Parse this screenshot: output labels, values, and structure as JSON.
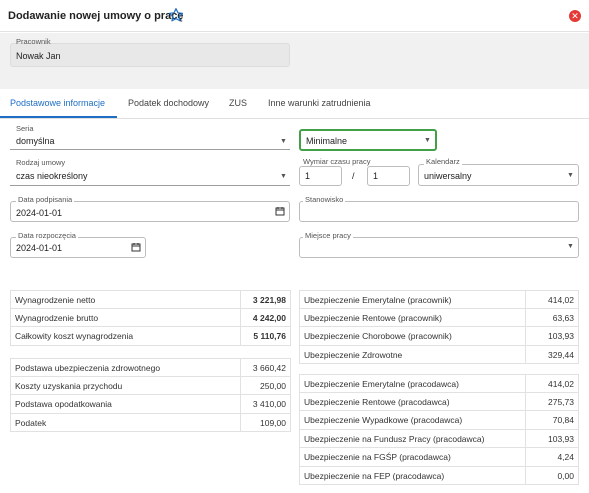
{
  "header": {
    "title": "Dodawanie nowej umowy o pracę",
    "star_icon": "star-outline-icon",
    "close_icon": "close-circle-icon",
    "close_color": "#e53935"
  },
  "employee": {
    "label": "Pracownik",
    "value": "Nowak Jan"
  },
  "tabs": [
    {
      "label": "Podstawowe informacje",
      "active": true
    },
    {
      "label": "Podatek dochodowy",
      "active": false
    },
    {
      "label": "ZUS",
      "active": false
    },
    {
      "label": "Inne warunki zatrudnienia",
      "active": false
    }
  ],
  "accent_color": "#1e6ec4",
  "highlight_color": "#43a047",
  "form": {
    "seria": {
      "label": "Seria",
      "value": "domyślna"
    },
    "minimalne": {
      "value": "Minimalne"
    },
    "rodzaj_umowy": {
      "label": "Rodzaj umowy",
      "value": "czas nieokreślony"
    },
    "wymiar": {
      "label": "Wymiar czasu pracy",
      "num": "1",
      "sep": "/",
      "den": "1"
    },
    "kalendarz": {
      "label": "Kalendarz",
      "value": "uniwersalny"
    },
    "data_podpisania": {
      "label": "Data podpisania",
      "value": "2024-01-01"
    },
    "stanowisko": {
      "label": "Stanowisko",
      "value": ""
    },
    "data_rozpoczecia": {
      "label": "Data rozpoczęcia",
      "value": "2024-01-01"
    },
    "miejsce_pracy": {
      "label": "Miejsce pracy",
      "value": ""
    }
  },
  "summary_left_top": [
    {
      "label": "Wynagrodzenie netto",
      "value": "3 221,98",
      "bold": true
    },
    {
      "label": "Wynagrodzenie brutto",
      "value": "4 242,00",
      "bold": true
    },
    {
      "label": "Całkowity koszt wynagrodzenia",
      "value": "5 110,76",
      "bold": true
    }
  ],
  "summary_left_bottom": [
    {
      "label": "Podstawa ubezpieczenia zdrowotnego",
      "value": "3 660,42"
    },
    {
      "label": "Koszty uzyskania przychodu",
      "value": "250,00"
    },
    {
      "label": "Podstawa opodatkowania",
      "value": "3 410,00"
    },
    {
      "label": "Podatek",
      "value": "109,00"
    }
  ],
  "summary_right_top": [
    {
      "label": "Ubezpieczenie Emerytalne (pracownik)",
      "value": "414,02"
    },
    {
      "label": "Ubezpieczenie Rentowe (pracownik)",
      "value": "63,63"
    },
    {
      "label": "Ubezpieczenie Chorobowe (pracownik)",
      "value": "103,93"
    },
    {
      "label": "Ubezpieczenie Zdrowotne",
      "value": "329,44"
    }
  ],
  "summary_right_bottom": [
    {
      "label": "Ubezpieczenie Emerytalne (pracodawca)",
      "value": "414,02"
    },
    {
      "label": "Ubezpieczenie Rentowe (pracodawca)",
      "value": "275,73"
    },
    {
      "label": "Ubezpieczenie Wypadkowe (pracodawca)",
      "value": "70,84"
    },
    {
      "label": "Ubezpieczenie na Fundusz Pracy (pracodawca)",
      "value": "103,93"
    },
    {
      "label": "Ubezpieczenie na FGŚP (pracodawca)",
      "value": "4,24"
    },
    {
      "label": "Ubezpieczenie na FEP (pracodawca)",
      "value": "0,00"
    }
  ]
}
